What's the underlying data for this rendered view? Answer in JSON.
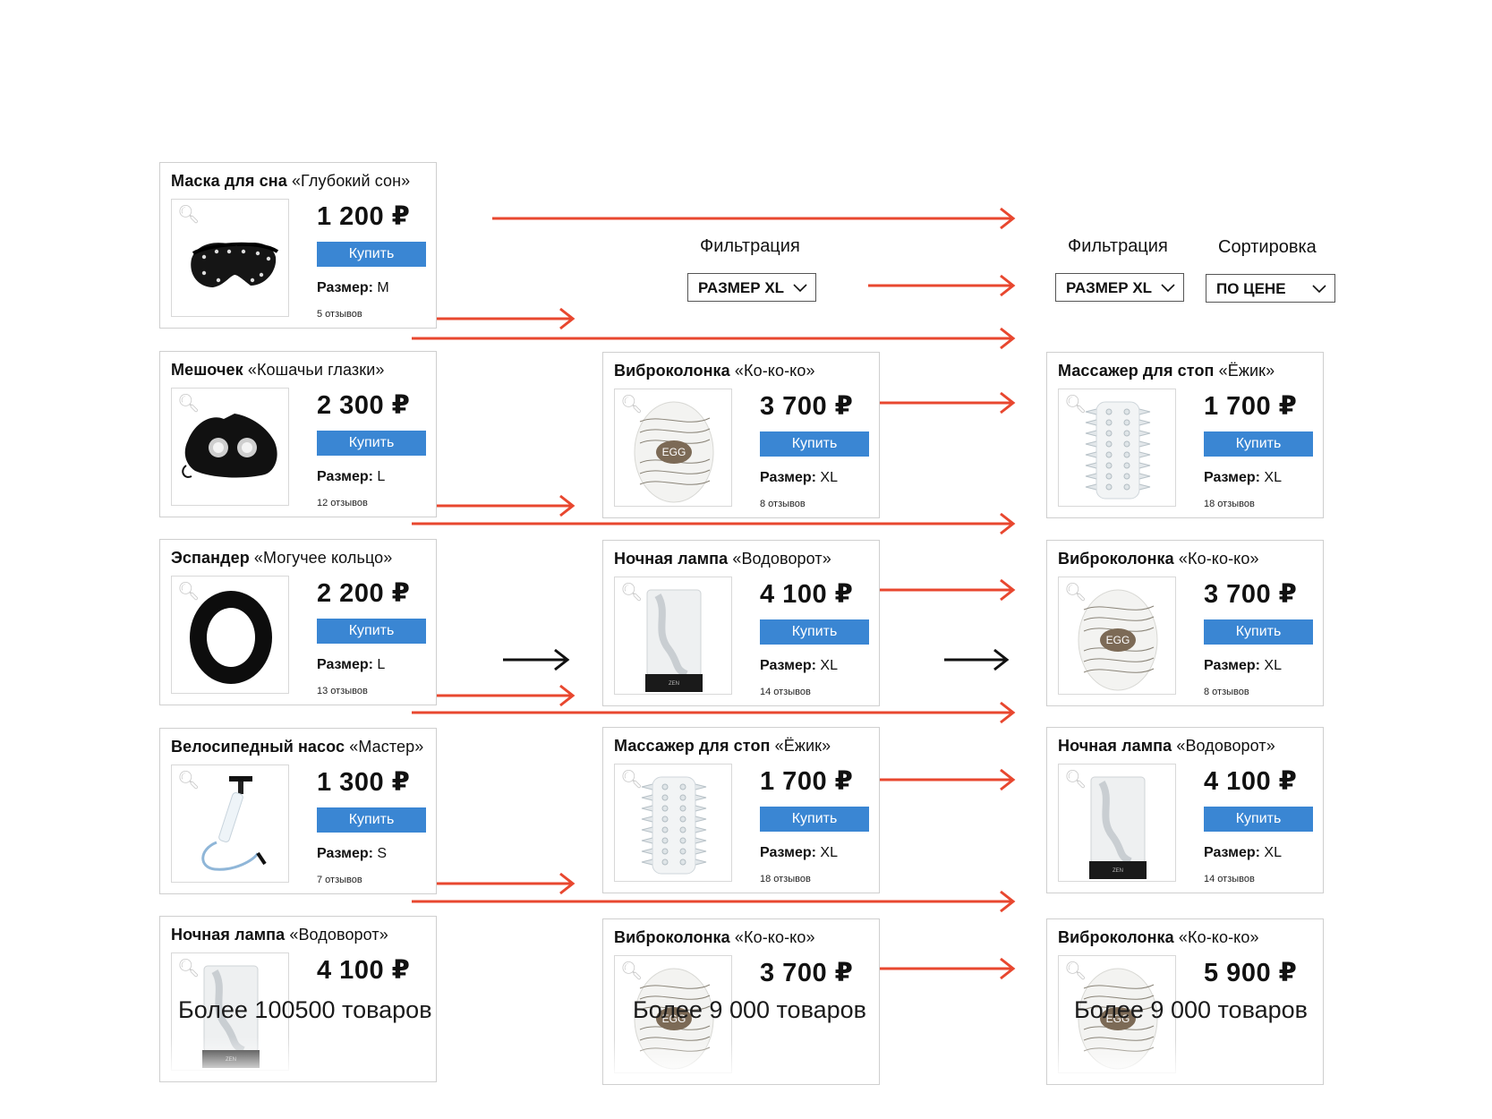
{
  "colors": {
    "arrow_red": "#e8472f",
    "arrow_black": "#111111",
    "buy_button": "#3a86d3",
    "border": "#cfcfcf"
  },
  "columns": [
    {
      "cards": [
        {
          "type": "Маска для сна",
          "name": "«Глубокий сон»",
          "price": "1 200 ₽",
          "buy": "Купить",
          "size_label": "Размер:",
          "size": "M",
          "reviews": "5 отзывов",
          "image": "sleep-mask",
          "faded": false
        },
        {
          "type": "Мешочек",
          "name": "«Кошачьи глазки»",
          "price": "2 300 ₽",
          "buy": "Купить",
          "size_label": "Размер:",
          "size": "L",
          "reviews": "12 отзывов",
          "image": "pouch",
          "faded": false
        },
        {
          "type": "Эспандер",
          "name": "«Могучее кольцо»",
          "price": "2 200 ₽",
          "buy": "Купить",
          "size_label": "Размер:",
          "size": "L",
          "reviews": "13 отзывов",
          "image": "ring",
          "faded": false
        },
        {
          "type": "Велосипедный насос",
          "name": "«Мастер»",
          "price": "1 300 ₽",
          "buy": "Купить",
          "size_label": "Размер:",
          "size": "S",
          "reviews": "7 отзывов",
          "image": "pump",
          "faded": false
        },
        {
          "type": "Ночная лампа",
          "name": "«Водоворот»",
          "price": "4 100 ₽",
          "buy": "",
          "size_label": "",
          "size": "",
          "reviews": "",
          "image": "lamp",
          "faded": true
        }
      ],
      "footer": "Более 100500 товаров"
    },
    {
      "filter_label": "Фильтрация",
      "filter_value": "РАЗМЕР XL",
      "cards": [
        {
          "type": "Виброколонка",
          "name": "«Ко-ко-ко»",
          "price": "3 700 ₽",
          "buy": "Купить",
          "size_label": "Размер:",
          "size": "XL",
          "reviews": "8 отзывов",
          "image": "egg",
          "faded": false
        },
        {
          "type": "Ночная лампа",
          "name": "«Водоворот»",
          "price": "4 100 ₽",
          "buy": "Купить",
          "size_label": "Размер:",
          "size": "XL",
          "reviews": "14 отзывов",
          "image": "lamp",
          "faded": false
        },
        {
          "type": "Массажер для стоп",
          "name": "«Ёжик»",
          "price": "1 700 ₽",
          "buy": "Купить",
          "size_label": "Размер:",
          "size": "XL",
          "reviews": "18 отзывов",
          "image": "spiky",
          "faded": false
        },
        {
          "type": "Виброколонка",
          "name": "«Ко-ко-ко»",
          "price": "3 700 ₽",
          "buy": "",
          "size_label": "",
          "size": "",
          "reviews": "",
          "image": "egg",
          "faded": true
        }
      ],
      "footer": "Более 9 000 товаров"
    },
    {
      "filter_label": "Фильтрация",
      "filter_value": "РАЗМЕР XL",
      "sort_label": "Сортировка",
      "sort_value": "ПО ЦЕНЕ",
      "cards": [
        {
          "type": "Массажер для стоп",
          "name": "«Ёжик»",
          "price": "1 700 ₽",
          "buy": "Купить",
          "size_label": "Размер:",
          "size": "XL",
          "reviews": "18 отзывов",
          "image": "spiky",
          "faded": false
        },
        {
          "type": "Виброколонка",
          "name": "«Ко-ко-ко»",
          "price": "3 700 ₽",
          "buy": "Купить",
          "size_label": "Размер:",
          "size": "XL",
          "reviews": "8 отзывов",
          "image": "egg",
          "faded": false
        },
        {
          "type": "Ночная лампа",
          "name": "«Водоворот»",
          "price": "4 100 ₽",
          "buy": "Купить",
          "size_label": "Размер:",
          "size": "XL",
          "reviews": "14 отзывов",
          "image": "lamp",
          "faded": false
        },
        {
          "type": "Виброколонка",
          "name": "«Ко-ко-ко»",
          "price": "5 900 ₽",
          "buy": "",
          "size_label": "",
          "size": "",
          "reviews": "",
          "image": "egg",
          "faded": true
        }
      ],
      "footer": "Более 9 000 товаров"
    }
  ]
}
